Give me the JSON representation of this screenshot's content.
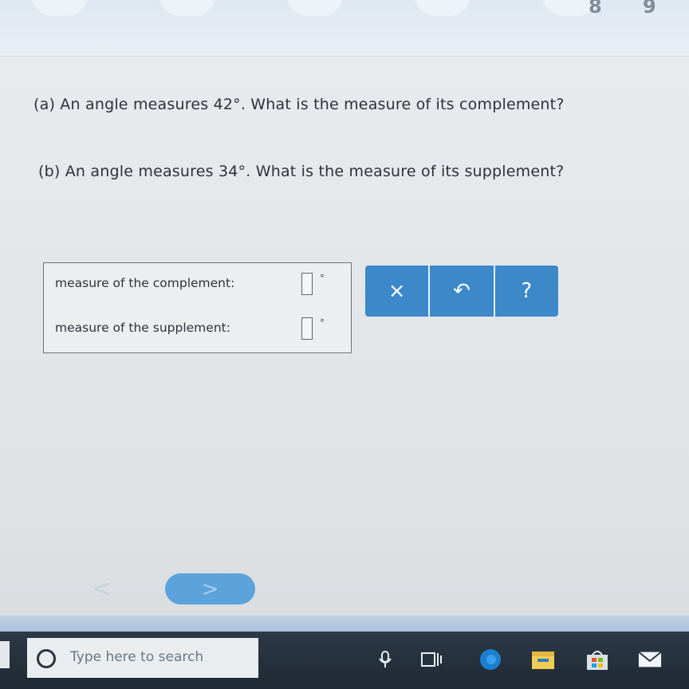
{
  "keyboard": {
    "digits": [
      "8",
      "9"
    ]
  },
  "questions": {
    "part_a": "(a) An angle measures 42°. What is the measure of its complement?",
    "part_b": "(b) An angle measures 34°. What is the measure of its supplement?"
  },
  "answers": {
    "complement_label": "measure of the complement:",
    "complement_value": "",
    "supplement_label": "measure of the supplement:",
    "supplement_value": "",
    "unit": "°"
  },
  "toolbar": {
    "clear_label": "×",
    "undo_label": "↶",
    "help_label": "?",
    "color": "#3d88c9"
  },
  "navigation": {
    "prev_label": "<",
    "next_label": ">"
  },
  "taskbar": {
    "search_placeholder": "Type here to search",
    "icons": [
      "search-icon",
      "microphone-icon",
      "task-view-icon",
      "edge-icon",
      "file-explorer-icon",
      "store-icon",
      "mail-icon"
    ]
  }
}
